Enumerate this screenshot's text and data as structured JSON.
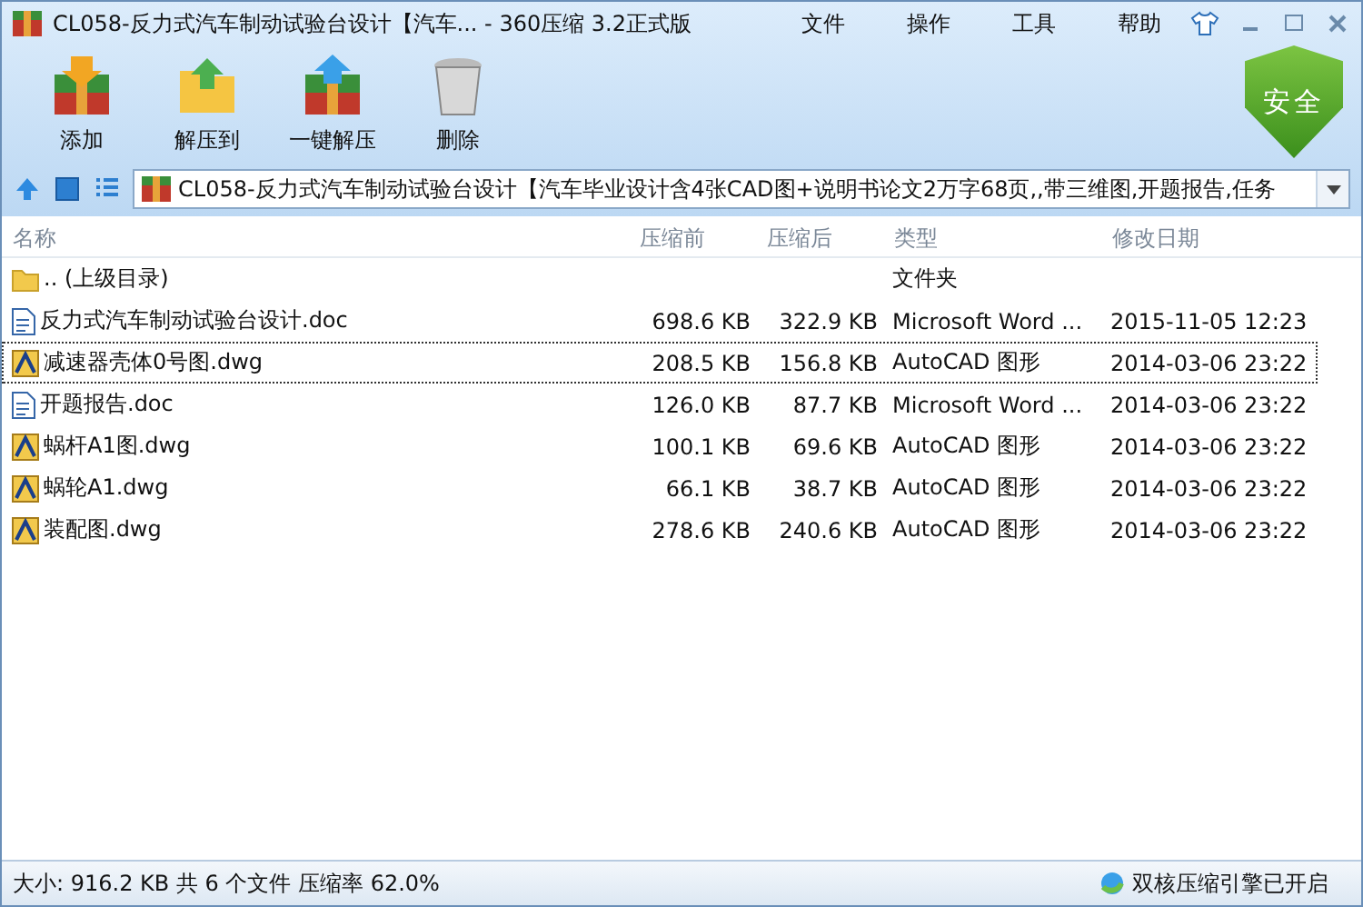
{
  "window": {
    "title": "CL058-反力式汽车制动试验台设计【汽车... - 360压缩 3.2正式版"
  },
  "menu": [
    "文件",
    "操作",
    "工具",
    "帮助"
  ],
  "toolbar": [
    {
      "kind": "add",
      "label": "添加"
    },
    {
      "kind": "extract",
      "label": "解压到"
    },
    {
      "kind": "oneclick",
      "label": "一键解压"
    },
    {
      "kind": "delete",
      "label": "删除"
    }
  ],
  "security_badge": {
    "label": "安全"
  },
  "address_bar": {
    "value": "CL058-反力式汽车制动试验台设计【汽车毕业设计含4张CAD图+说明书论文2万字68页,,带三维图,开题报告,任务"
  },
  "table": {
    "columns": [
      "名称",
      "压缩前",
      "压缩后",
      "类型",
      "修改日期"
    ],
    "rows": [
      {
        "kind": "folder",
        "focused": false,
        "cells": [
          ".. (上级目录)",
          "",
          "",
          "文件夹",
          ""
        ]
      },
      {
        "kind": "doc",
        "focused": false,
        "cells": [
          "反力式汽车制动试验台设计.doc",
          "698.6 KB",
          "322.9 KB",
          "Microsoft Word ...",
          "2015-11-05 12:23"
        ]
      },
      {
        "kind": "dwg",
        "focused": true,
        "cells": [
          "减速器壳体0号图.dwg",
          "208.5 KB",
          "156.8 KB",
          "AutoCAD 图形",
          "2014-03-06 23:22"
        ]
      },
      {
        "kind": "doc",
        "focused": false,
        "cells": [
          "开题报告.doc",
          "126.0 KB",
          "87.7 KB",
          "Microsoft Word ...",
          "2014-03-06 23:22"
        ]
      },
      {
        "kind": "dwg",
        "focused": false,
        "cells": [
          "蜗杆A1图.dwg",
          "100.1 KB",
          "69.6 KB",
          "AutoCAD 图形",
          "2014-03-06 23:22"
        ]
      },
      {
        "kind": "dwg",
        "focused": false,
        "cells": [
          "蜗轮A1.dwg",
          "66.1 KB",
          "38.7 KB",
          "AutoCAD 图形",
          "2014-03-06 23:22"
        ]
      },
      {
        "kind": "dwg",
        "focused": false,
        "cells": [
          "装配图.dwg",
          "278.6 KB",
          "240.6 KB",
          "AutoCAD 图形",
          "2014-03-06 23:22"
        ]
      }
    ]
  },
  "status_bar": {
    "summary": "大小: 916.2 KB 共 6 个文件 压缩率 62.0%",
    "engine": "双核压缩引擎已开启"
  }
}
